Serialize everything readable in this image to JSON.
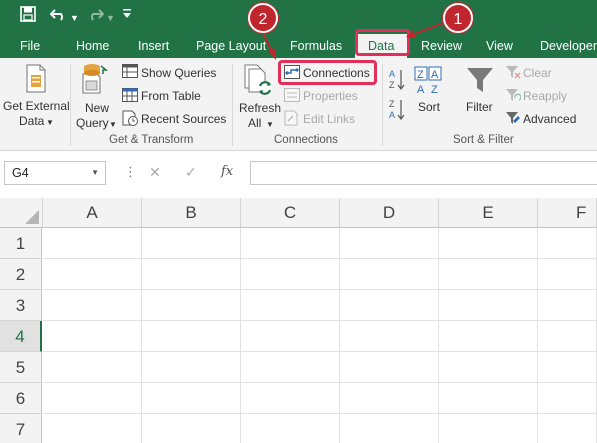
{
  "quick_access": {
    "save_icon": "save-icon",
    "undo_icon": "undo-icon",
    "redo_icon": "redo-icon",
    "customize_icon": "customize-qat-icon"
  },
  "tabs": [
    {
      "label": "File"
    },
    {
      "label": "Home"
    },
    {
      "label": "Insert"
    },
    {
      "label": "Page Layout"
    },
    {
      "label": "Formulas"
    },
    {
      "label": "Data"
    },
    {
      "label": "Review"
    },
    {
      "label": "View"
    },
    {
      "label": "Developer"
    }
  ],
  "active_tab": "Data",
  "annotations": [
    {
      "number": "1",
      "target": "Data"
    },
    {
      "number": "2",
      "target": "Connections"
    }
  ],
  "ribbon": {
    "get_external": {
      "line1": "Get External",
      "line2": "Data"
    },
    "get_transform": {
      "new_query": {
        "line1": "New",
        "line2": "Query"
      },
      "show_queries": "Show Queries",
      "from_table": "From Table",
      "recent_sources": "Recent Sources",
      "label": "Get & Transform"
    },
    "connections": {
      "refresh": {
        "line1": "Refresh",
        "line2": "All"
      },
      "connections": "Connections",
      "properties": "Properties",
      "edit_links": "Edit Links",
      "label": "Connections"
    },
    "sort_filter": {
      "sort": "Sort",
      "filter": "Filter",
      "clear": "Clear",
      "reapply": "Reapply",
      "advanced": "Advanced",
      "label": "Sort & Filter"
    }
  },
  "formula_bar": {
    "name_box": "G4",
    "cancel_symbol": "✕",
    "enter_symbol": "✓",
    "fx_symbol": "fx",
    "formula": ""
  },
  "grid": {
    "columns": [
      "A",
      "B",
      "C",
      "D",
      "E",
      "F"
    ],
    "rows": [
      "1",
      "2",
      "3",
      "4",
      "5",
      "6",
      "7"
    ],
    "selected_row": "4"
  },
  "colors": {
    "excel_green": "#217346",
    "annotation_red": "#c0262d",
    "highlight_pink": "#e0305a"
  }
}
